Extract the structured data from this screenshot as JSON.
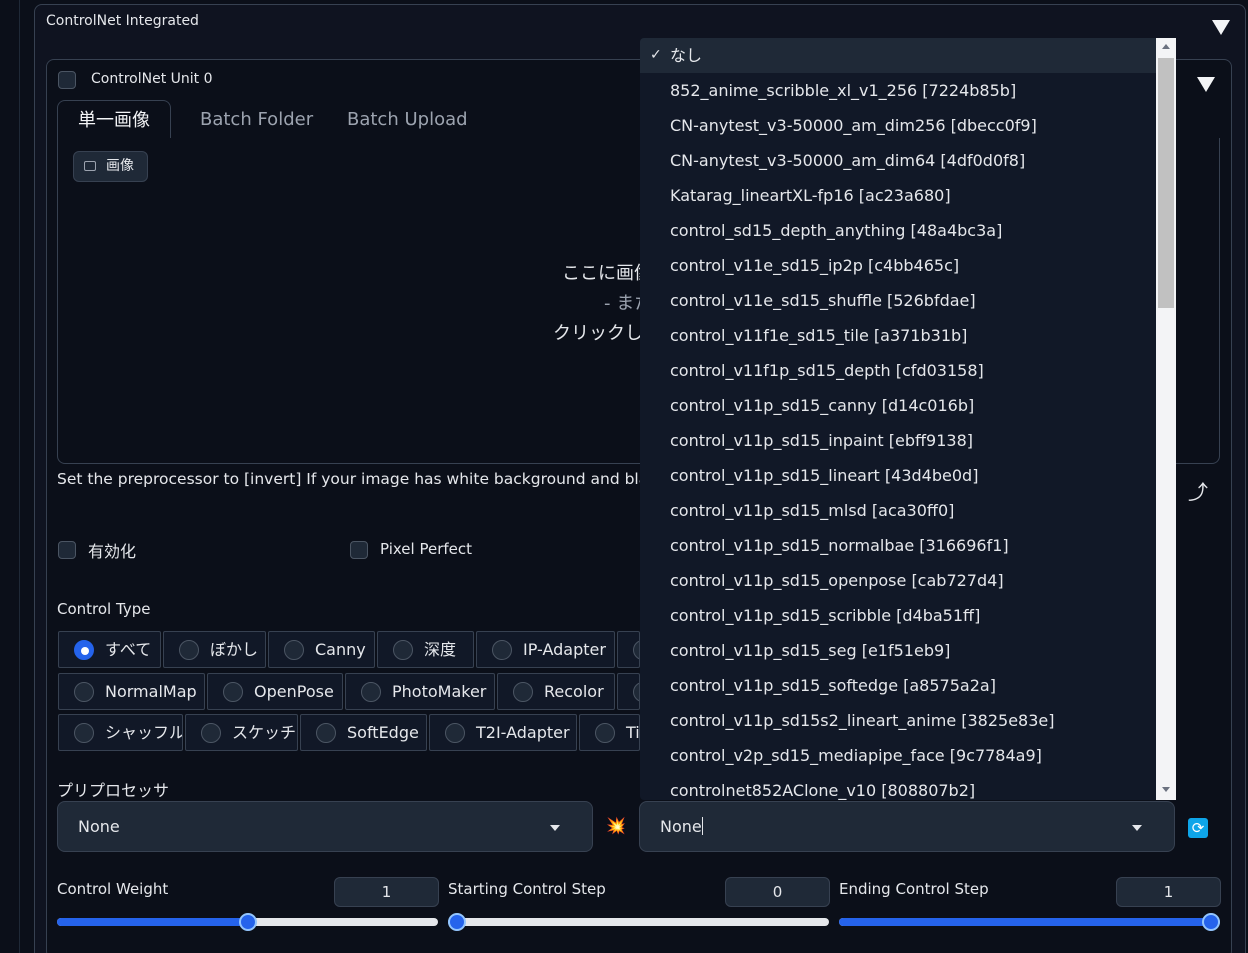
{
  "outer": {
    "title": "ControlNet Integrated"
  },
  "unit": {
    "title": "ControlNet Unit 0"
  },
  "tabs": [
    {
      "label": "単一画像"
    },
    {
      "label": "Batch Folder"
    },
    {
      "label": "Batch Upload"
    }
  ],
  "image_upload": {
    "chip_label": "画像",
    "drop_line1": "ここに画像",
    "drop_line2": "- また",
    "drop_line3": "クリックして"
  },
  "hint_text": "Set the preprocessor to [invert] If your image has white background and black lin",
  "checkboxes": {
    "enable": "有効化",
    "pixel_perfect": "Pixel Perfect"
  },
  "control_type": {
    "label": "Control Type",
    "row1": [
      "すべて",
      "ぼかし",
      "Canny",
      "深度",
      "IP-Adapter"
    ],
    "row2": [
      "NormalMap",
      "OpenPose",
      "PhotoMaker",
      "Recolor"
    ],
    "row3": [
      "シャッフル",
      "スケッチ",
      "SoftEdge",
      "T2I-Adapter",
      "Ti"
    ],
    "selected": "すべて"
  },
  "preprocessor": {
    "label": "プリプロセッサ",
    "value": "None"
  },
  "model": {
    "value": "None"
  },
  "sliders": {
    "control_weight": {
      "label": "Control Weight",
      "value": "1",
      "level": 0.5
    },
    "starting_step": {
      "label": "Starting Control Step",
      "value": "0",
      "level": 0.0
    },
    "ending_step": {
      "label": "Ending Control Step",
      "value": "1",
      "level": 1.0
    }
  },
  "dropdown": {
    "check_mark": "✓",
    "items": [
      "なし",
      "852_anime_scribble_xl_v1_256 [7224b85b]",
      "CN-anytest_v3-50000_am_dim256 [dbecc0f9]",
      "CN-anytest_v3-50000_am_dim64 [4df0d0f8]",
      "Katarag_lineartXL-fp16 [ac23a680]",
      "control_sd15_depth_anything [48a4bc3a]",
      "control_v11e_sd15_ip2p [c4bb465c]",
      "control_v11e_sd15_shuffle [526bfdae]",
      "control_v11f1e_sd15_tile [a371b31b]",
      "control_v11f1p_sd15_depth [cfd03158]",
      "control_v11p_sd15_canny [d14c016b]",
      "control_v11p_sd15_inpaint [ebff9138]",
      "control_v11p_sd15_lineart [43d4be0d]",
      "control_v11p_sd15_mlsd [aca30ff0]",
      "control_v11p_sd15_normalbae [316696f1]",
      "control_v11p_sd15_openpose [cab727d4]",
      "control_v11p_sd15_scribble [d4ba51ff]",
      "control_v11p_sd15_seg [e1f51eb9]",
      "control_v11p_sd15_softedge [a8575a2a]",
      "control_v11p_sd15s2_lineart_anime [3825e83e]",
      "control_v2p_sd15_mediapipe_face [9c7784a9]",
      "controlnet852AClone_v10 [808807b2]"
    ],
    "selected_index": 0
  },
  "icons": {
    "explosion": "💥",
    "send": "⤴",
    "refresh": "⟳"
  },
  "colors": {
    "accent": "#2563eb",
    "background": "#0b0f19"
  }
}
